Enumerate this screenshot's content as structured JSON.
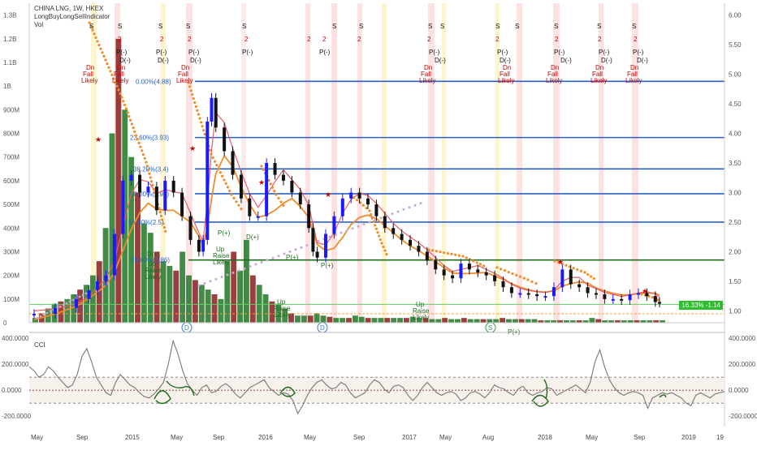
{
  "header": {
    "title": "CHINA LNG, 1W, HKEX",
    "indicator": "LongBuyLongSellIndicator",
    "volume_label": "Vol"
  },
  "cci_label": "CCI",
  "price_badge": "16.33% -1.14",
  "colors": {
    "up_candle": "#1a1aff",
    "down_candle": "#111111",
    "vol_up": "#2e7d32",
    "vol_down": "#8e2a2a",
    "fib_line": "#2a62c9",
    "green_line": "#1e6b1e",
    "orange_ma": "#f28c28",
    "red_ma": "#e85c6a",
    "cci_line": "#777777",
    "signal_red": "#cc0000"
  },
  "fib_labels": [
    "0.00%(4.88)",
    "23.60%(3.93)",
    "38.20%(3.4)",
    "50.00%(2.98)",
    "61.80%(2.5)",
    "78.60%(1.86)"
  ],
  "signals": {
    "dn": [
      "Dn",
      "Fall",
      "Likely"
    ],
    "up": [
      "Up",
      "Raise",
      "Likely"
    ],
    "s": "S",
    "d": "D",
    "p_minus": "P(-)",
    "d_minus": "D(-)",
    "p_plus": "P(+)",
    "d_plus": "D(+)",
    "dd_minus": "D(D(-)",
    "ppm_minus": "P(-) P(P(-)"
  },
  "chart_data": [
    {
      "type": "candlestick",
      "title": "CHINA LNG, 1W, HKEX",
      "x_ticks": [
        "May",
        "Sep",
        "2015",
        "May",
        "Sep",
        "2016",
        "May",
        "Sep",
        "2017",
        "May",
        "Aug",
        "2018",
        "May",
        "Sep",
        "2019",
        "19"
      ],
      "y_right_ticks": [
        "6.00",
        "5.50",
        "5.00",
        "4.50",
        "4.00",
        "3.50",
        "3.00",
        "2.50",
        "2.00",
        "1.50",
        "1.00"
      ],
      "y_left_ticks": [
        "1.3B",
        "1.2B",
        "1.1B",
        "1B",
        "900M",
        "800M",
        "700M",
        "600M",
        "500M",
        "400M",
        "300M",
        "200M",
        "100M",
        "0"
      ],
      "ylim_price": [
        0.8,
        6.2
      ],
      "ylim_volume": [
        0,
        1350000000
      ],
      "horizontal_levels": [
        {
          "label": "0.00%(4.88)",
          "value": 4.88
        },
        {
          "label": "23.60%(3.93)",
          "value": 3.93
        },
        {
          "label": "38.20%(3.4)",
          "value": 3.4
        },
        {
          "label": "50.00%(2.98)",
          "value": 2.98
        },
        {
          "label": "61.80%(2.5)",
          "value": 2.5
        },
        {
          "label": "78.60%(1.86)",
          "value": 1.86
        }
      ],
      "price_path": [
        [
          0,
          0.95
        ],
        [
          5,
          1.05
        ],
        [
          10,
          1.2
        ],
        [
          13,
          1.35
        ],
        [
          15,
          1.5
        ],
        [
          17,
          1.6
        ],
        [
          19,
          2.3
        ],
        [
          21,
          3.2
        ],
        [
          23,
          3.3
        ],
        [
          25,
          3.0
        ],
        [
          27,
          3.1
        ],
        [
          29,
          2.7
        ],
        [
          31,
          3.2
        ],
        [
          33,
          3.0
        ],
        [
          35,
          2.6
        ],
        [
          37,
          2.2
        ],
        [
          39,
          2.0
        ],
        [
          40,
          2.2
        ],
        [
          41,
          4.2
        ],
        [
          42,
          4.6
        ],
        [
          43,
          4.1
        ],
        [
          45,
          3.7
        ],
        [
          47,
          3.3
        ],
        [
          49,
          2.9
        ],
        [
          51,
          2.6
        ],
        [
          53,
          2.6
        ],
        [
          55,
          3.5
        ],
        [
          57,
          3.3
        ],
        [
          59,
          3.2
        ],
        [
          61,
          3.0
        ],
        [
          63,
          2.8
        ],
        [
          65,
          2.4
        ],
        [
          66,
          2.0
        ],
        [
          67,
          1.9
        ],
        [
          69,
          2.3
        ],
        [
          71,
          2.6
        ],
        [
          73,
          2.9
        ],
        [
          75,
          3.0
        ],
        [
          77,
          2.9
        ],
        [
          79,
          2.8
        ],
        [
          81,
          2.6
        ],
        [
          83,
          2.4
        ],
        [
          85,
          2.3
        ],
        [
          87,
          2.2
        ],
        [
          89,
          2.1
        ],
        [
          91,
          2.0
        ],
        [
          93,
          1.85
        ],
        [
          95,
          1.7
        ],
        [
          97,
          1.6
        ],
        [
          99,
          1.55
        ],
        [
          101,
          1.8
        ],
        [
          103,
          1.7
        ],
        [
          105,
          1.65
        ],
        [
          107,
          1.6
        ],
        [
          109,
          1.5
        ],
        [
          111,
          1.4
        ],
        [
          113,
          1.3
        ],
        [
          115,
          1.3
        ],
        [
          117,
          1.28
        ],
        [
          119,
          1.25
        ],
        [
          121,
          1.25
        ],
        [
          123,
          1.4
        ],
        [
          125,
          1.7
        ],
        [
          127,
          1.45
        ],
        [
          129,
          1.4
        ],
        [
          131,
          1.3
        ],
        [
          133,
          1.28
        ],
        [
          135,
          1.2
        ],
        [
          137,
          1.2
        ],
        [
          139,
          1.18
        ],
        [
          141,
          1.28
        ],
        [
          143,
          1.3
        ],
        [
          145,
          1.25
        ],
        [
          147,
          1.15
        ],
        [
          148,
          1.14
        ]
      ],
      "volume_bars_millions": [
        20,
        40,
        60,
        80,
        90,
        100,
        120,
        140,
        160,
        200,
        260,
        400,
        800,
        1200,
        900,
        700,
        550,
        420,
        380,
        300,
        260,
        240,
        220,
        300,
        200,
        180,
        160,
        140,
        120,
        100,
        260,
        300,
        220,
        350,
        200,
        160,
        120,
        90,
        80,
        60,
        40,
        30,
        30,
        30,
        40,
        30,
        25,
        20,
        20,
        20,
        30,
        25,
        20,
        20,
        20,
        20,
        20,
        20,
        20,
        25,
        20,
        20,
        15,
        15,
        20,
        15,
        15,
        20,
        15,
        15,
        15,
        15,
        15,
        20,
        15,
        15,
        15,
        15,
        15,
        10,
        10,
        10,
        10,
        10,
        10,
        10,
        10,
        20,
        15,
        10,
        10,
        10,
        10,
        10,
        10,
        10,
        10,
        10,
        10
      ]
    },
    {
      "type": "line",
      "title": "CCI",
      "y_right_ticks": [
        "400.0000",
        "200.0000",
        "0.0000",
        "-200.0000"
      ],
      "y_left_ticks": [
        "400.0000",
        "200.0000",
        "0.0000",
        "-200.0000"
      ],
      "ylim": [
        -280,
        420
      ],
      "bands": [
        100,
        -100
      ],
      "values": [
        180,
        150,
        100,
        120,
        180,
        150,
        100,
        60,
        20,
        40,
        120,
        260,
        320,
        220,
        100,
        40,
        -20,
        -40,
        60,
        120,
        80,
        40,
        20,
        -20,
        -50,
        -60,
        -30,
        10,
        60,
        200,
        380,
        280,
        150,
        50,
        0,
        -40,
        20,
        40,
        -20,
        -10,
        30,
        50,
        20,
        -30,
        -60,
        -20,
        20,
        40,
        60,
        80,
        20,
        -10,
        -40,
        -20,
        -30,
        -80,
        -180,
        -120,
        -40,
        20,
        60,
        80,
        40,
        10,
        20,
        60,
        40,
        -20,
        -60,
        -40,
        -20,
        40,
        80,
        60,
        10,
        -20,
        30,
        40,
        20,
        -40,
        -80,
        -40,
        20,
        60,
        20,
        -20,
        -40,
        -20,
        -10,
        -30,
        -80,
        -60,
        -20,
        -10,
        -30,
        -60,
        -20,
        40,
        20,
        10,
        -20,
        -40,
        10,
        30,
        -20,
        -40,
        -20,
        -10,
        20,
        10,
        -40,
        -20,
        0,
        20,
        40,
        10,
        -20,
        60,
        220,
        310,
        180,
        80,
        20,
        -20,
        -40,
        -20,
        -10,
        -20,
        -40,
        -140,
        -60,
        -40,
        -20,
        -30,
        -20,
        -40,
        -60,
        -100,
        -120,
        -40,
        -20,
        -40,
        -60,
        -30,
        -20,
        -10
      ]
    }
  ]
}
